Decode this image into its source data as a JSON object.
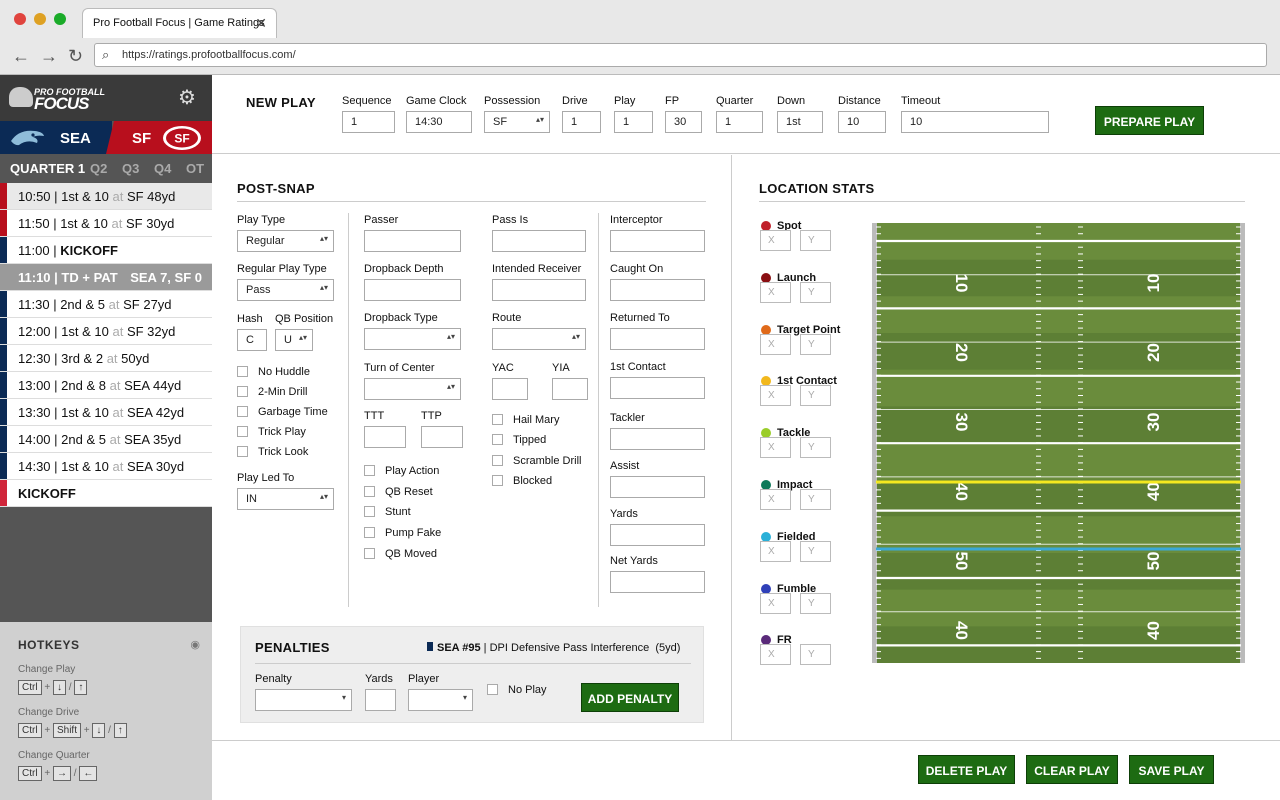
{
  "browser": {
    "tab_title": "Pro Football Focus | Game Ratings",
    "url": "https://ratings.profootballfocus.com/"
  },
  "sidebar": {
    "logo_line1": "PRO FOOTBALL",
    "logo_line2": "FOCUS",
    "logo_badge": "PFF",
    "team_a": "SEA",
    "team_b": "SF",
    "quarters": [
      "QUARTER 1",
      "Q2",
      "Q3",
      "Q4",
      "OT"
    ],
    "plays": [
      {
        "time": "10:50",
        "down": "1st & 10",
        "at": "at",
        "spot": "SF 48yd"
      },
      {
        "time": "11:50",
        "down": "1st & 10",
        "at": "at",
        "spot": "SF 30yd"
      },
      {
        "time": "11:00",
        "event": "KICKOFF"
      },
      {
        "time": "11:10",
        "event": "TD + PAT",
        "score": "SEA 7, SF 0"
      },
      {
        "time": "11:30",
        "down": "2nd & 5",
        "at": "at",
        "spot": "SF 27yd"
      },
      {
        "time": "12:00",
        "down": "1st & 10",
        "at": "at",
        "spot": "SF 32yd"
      },
      {
        "time": "12:30",
        "down": "3rd & 2",
        "at": "at",
        "spot": "50yd"
      },
      {
        "time": "13:00",
        "down": "2nd & 8",
        "at": "at",
        "spot": "SEA 44yd"
      },
      {
        "time": "13:30",
        "down": "1st & 10",
        "at": "at",
        "spot": "SEA 42yd"
      },
      {
        "time": "14:00",
        "down": "2nd & 5",
        "at": "at",
        "spot": "SEA 35yd"
      },
      {
        "time": "14:30",
        "down": "1st & 10",
        "at": "at",
        "spot": "SEA 30yd"
      },
      {
        "event": "KICKOFF"
      }
    ],
    "hotkeys": {
      "title": "HOTKEYS",
      "change_play": "Change Play",
      "change_drive": "Change Drive",
      "change_quarter": "Change Quarter",
      "ctrl": "Ctrl",
      "shift": "Shift",
      "plus": "+",
      "slash": "/",
      "down_arrow": "↓",
      "up_arrow": "↑",
      "right_arrow": "→",
      "left_arrow": "←"
    }
  },
  "new_play": {
    "title": "NEW PLAY",
    "sequence_label": "Sequence",
    "sequence": "1",
    "game_clock_label": "Game Clock",
    "game_clock": "14:30",
    "possession_label": "Possession",
    "possession": "SF",
    "drive_label": "Drive",
    "drive": "1",
    "play_label": "Play",
    "play": "1",
    "fp_label": "FP",
    "fp": "30",
    "quarter_label": "Quarter",
    "quarter": "1",
    "down_label": "Down",
    "down": "1st",
    "distance_label": "Distance",
    "distance": "10",
    "timeout_label": "Timeout",
    "timeout": "10",
    "prepare_button": "PREPARE PLAY"
  },
  "post_snap": {
    "title": "POST-SNAP",
    "play_type_label": "Play Type",
    "play_type": "Regular",
    "regular_play_type_label": "Regular Play Type",
    "regular_play_type": "Pass",
    "hash_label": "Hash",
    "hash": "C",
    "qb_position_label": "QB Position",
    "qb_position": "U",
    "checks_a": [
      "No Huddle",
      "2-Min Drill",
      "Garbage Time",
      "Trick Play",
      "Trick Look"
    ],
    "play_led_to_label": "Play Led To",
    "play_led_to": "IN",
    "passer_label": "Passer",
    "dropback_depth_label": "Dropback Depth",
    "dropback_type_label": "Dropback Type",
    "turn_of_center_label": "Turn of Center",
    "ttt_label": "TTT",
    "ttp_label": "TTP",
    "checks_b": [
      "Play Action",
      "QB Reset",
      "Stunt",
      "Pump Fake",
      "QB Moved"
    ],
    "pass_is_label": "Pass Is",
    "intended_receiver_label": "Intended Receiver",
    "route_label": "Route",
    "yac_label": "YAC",
    "yia_label": "YIA",
    "checks_c": [
      "Hail Mary",
      "Tipped",
      "Scramble Drill",
      "Blocked"
    ],
    "interceptor_label": "Interceptor",
    "caught_on_label": "Caught On",
    "returned_to_label": "Returned To",
    "first_contact_label": "1st Contact",
    "tackler_label": "Tackler",
    "assist_label": "Assist",
    "yards_label": "Yards",
    "net_yards_label": "Net Yards"
  },
  "penalties": {
    "title": "PENALTIES",
    "entry_team": "SEA #95",
    "entry_desc": "DPI Defensive Pass Interference",
    "entry_yds": "(5yd)",
    "penalty_label": "Penalty",
    "yards_label": "Yards",
    "player_label": "Player",
    "no_play_label": "No Play",
    "add_button": "ADD PENALTY"
  },
  "location_stats": {
    "title": "LOCATION STATS",
    "x_ph": "X",
    "y_ph": "Y",
    "items": [
      {
        "name": "Spot",
        "color": "#c0202a"
      },
      {
        "name": "Launch",
        "color": "#8a0f12"
      },
      {
        "name": "Target Point",
        "color": "#e06a1a"
      },
      {
        "name": "1st Contact",
        "color": "#f2b81d"
      },
      {
        "name": "Tackle",
        "color": "#9acd2a"
      },
      {
        "name": "Impact",
        "color": "#0f7a5a"
      },
      {
        "name": "Fielded",
        "color": "#2ab0d8"
      },
      {
        "name": "Fumble",
        "color": "#3040b8"
      },
      {
        "name": "FR",
        "color": "#5a2a7a"
      }
    ],
    "field_numbers": [
      {
        "left": "10",
        "right": "10"
      },
      {
        "left": "20",
        "right": "20"
      },
      {
        "left": "30",
        "right": "30"
      },
      {
        "left": "40",
        "right": "40"
      },
      {
        "left": "50",
        "right": "50"
      },
      {
        "left": "40",
        "right": "40"
      }
    ]
  },
  "footer": {
    "delete_button": "DELETE PLAY",
    "clear_button": "CLEAR PLAY",
    "save_button": "SAVE PLAY"
  },
  "colors": {
    "accent_green": "#1d6b12",
    "sea_navy": "#0b2a55",
    "sf_red": "#b80f1d"
  }
}
